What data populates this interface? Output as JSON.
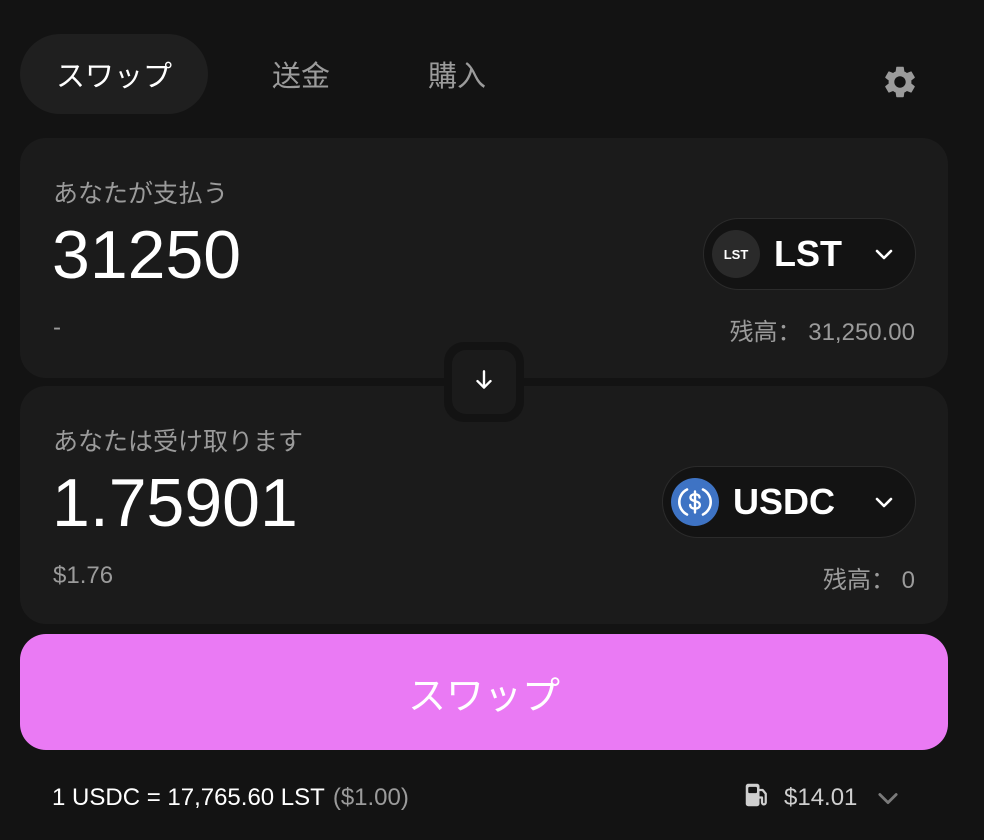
{
  "tabs": [
    {
      "label": "スワップ",
      "active": true
    },
    {
      "label": "送金",
      "active": false
    },
    {
      "label": "購入",
      "active": false
    }
  ],
  "settings_icon": "gear-icon",
  "pay": {
    "label": "あなたが支払う",
    "amount": "31250",
    "usd_value": "-",
    "token": {
      "symbol": "LST",
      "logo_text": "LST"
    },
    "balance": "残高： 31,250.00"
  },
  "receive": {
    "label": "あなたは受け取ります",
    "amount": "1.75901",
    "usd_value": "$1.76",
    "token": {
      "symbol": "USDC",
      "logo_color": "#3e73c4"
    },
    "balance": "残高： 0"
  },
  "swap_button": {
    "label": "スワップ",
    "color": "#ea7af4"
  },
  "footer": {
    "rate": "1 USDC = 17,765.60 LST",
    "rate_usd": "($1.00)",
    "gas": "$14.01"
  }
}
